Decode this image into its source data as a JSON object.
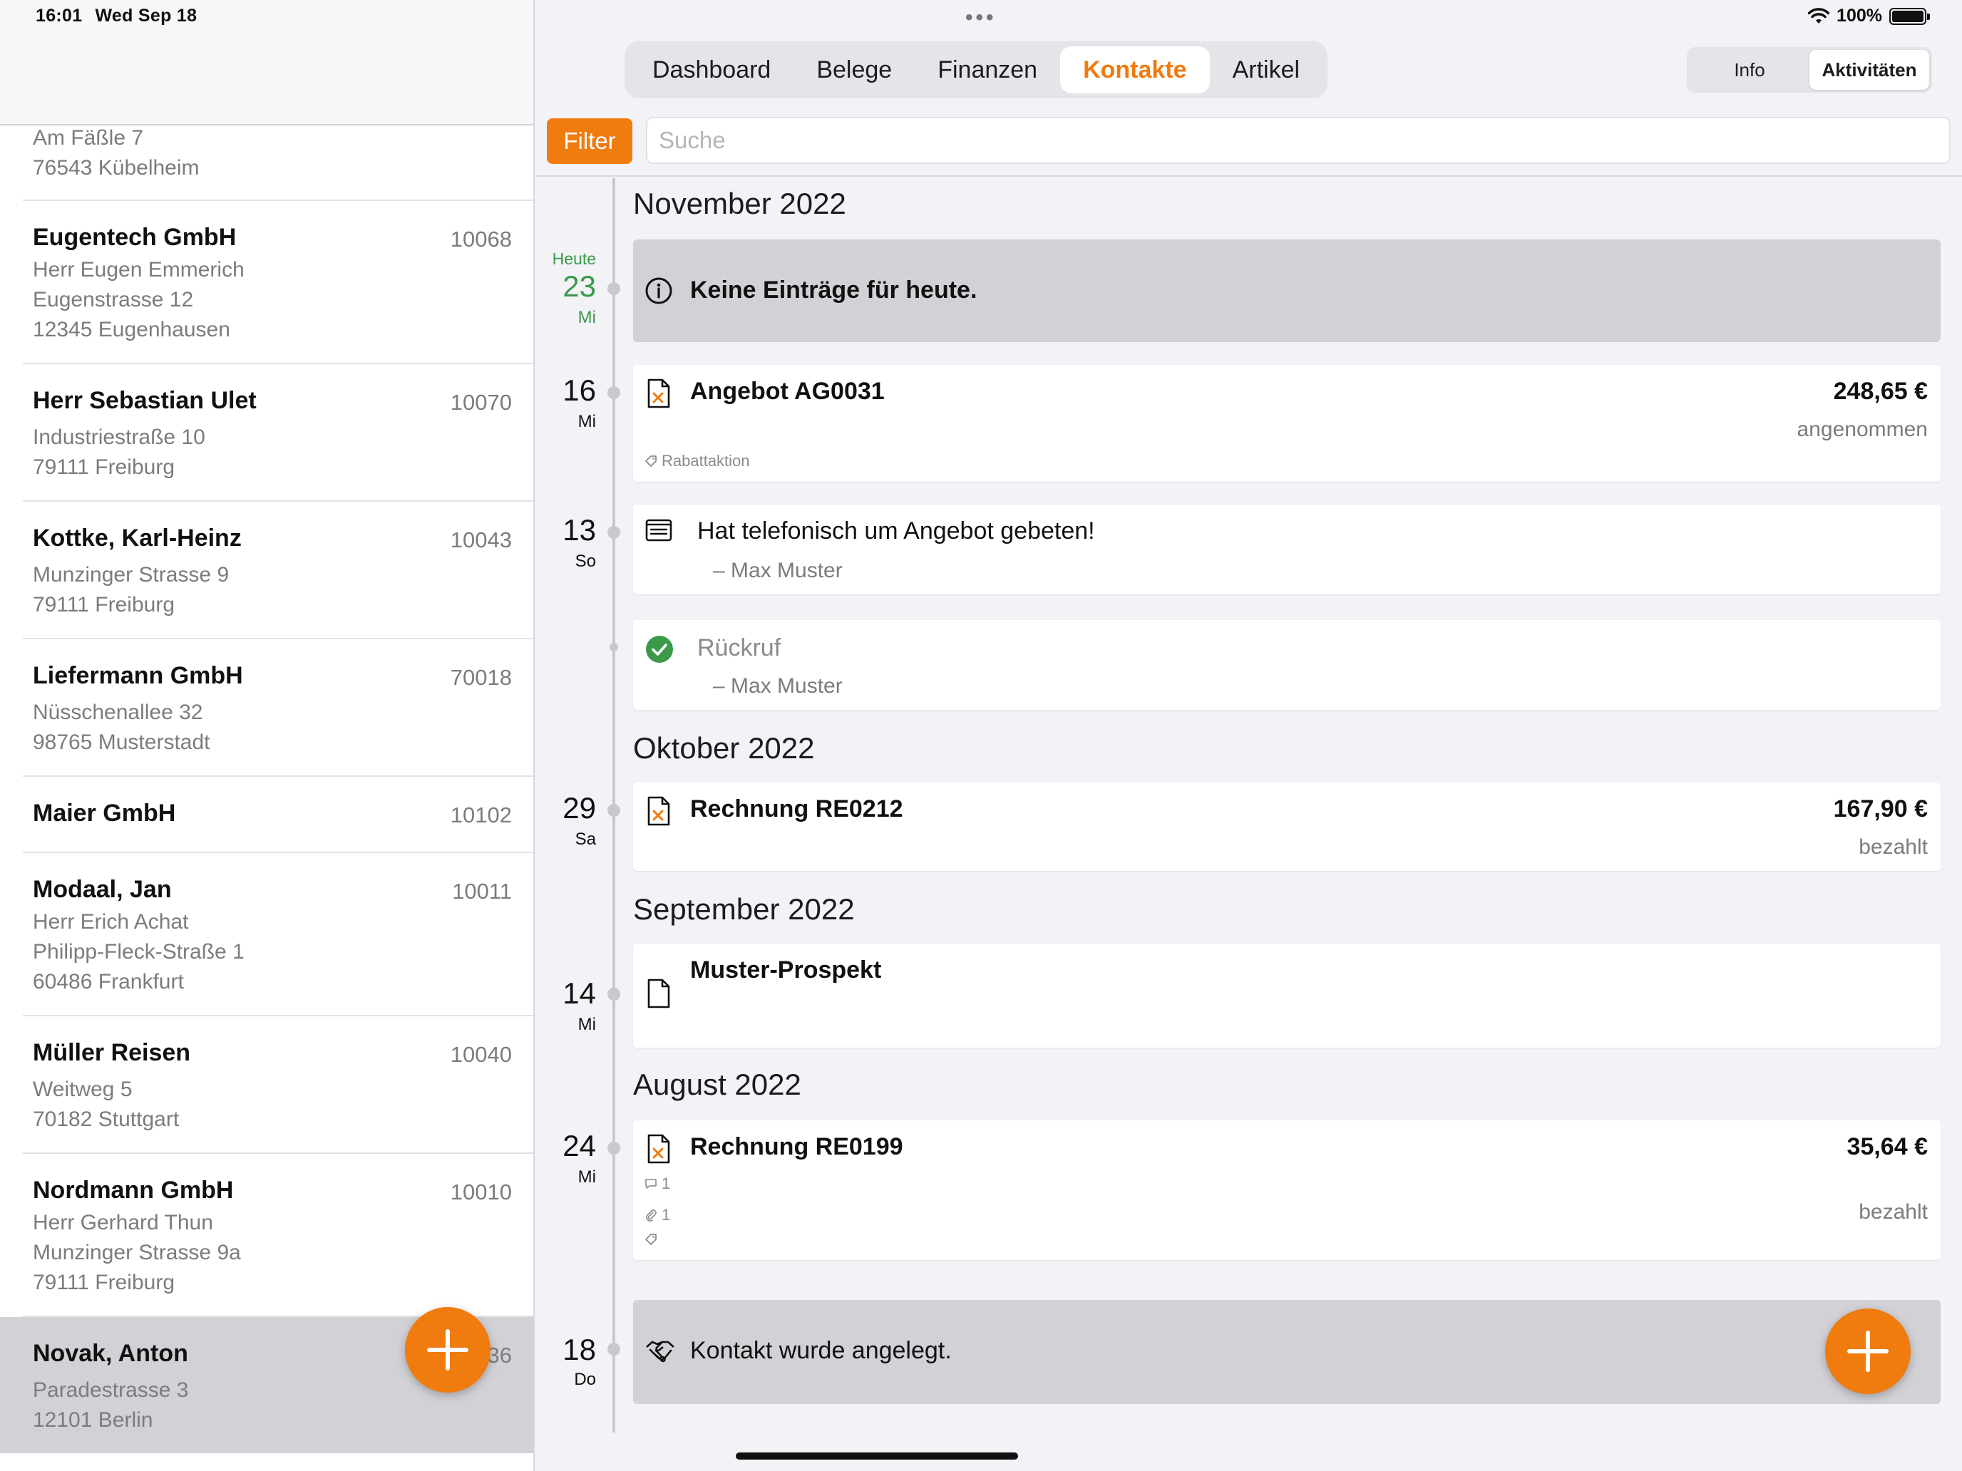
{
  "status": {
    "time": "16:01",
    "date": "Wed Sep 18",
    "battery": "100%"
  },
  "contacts": [
    {
      "name": "",
      "number": "",
      "lines": [
        "Am Fäßle 7",
        "76543  Kübelheim"
      ]
    },
    {
      "name": "Eugentech GmbH",
      "number": "10068",
      "lines": [
        "Herr Eugen Emmerich",
        "Eugenstrasse 12",
        "12345  Eugenhausen"
      ]
    },
    {
      "name": "Herr Sebastian Ulet",
      "number": "10070",
      "lines": [
        "Industriestraße 10",
        "79111  Freiburg"
      ]
    },
    {
      "name": "Kottke, Karl-Heinz",
      "number": "10043",
      "lines": [
        "Munzinger Strasse 9",
        "79111  Freiburg"
      ]
    },
    {
      "name": "Liefermann GmbH",
      "number": "70018",
      "lines": [
        "Nüsschenallee 32",
        "98765  Musterstadt"
      ]
    },
    {
      "name": "Maier GmbH",
      "number": "10102",
      "lines": []
    },
    {
      "name": "Modaal, Jan",
      "number": "10011",
      "lines": [
        "Herr Erich Achat",
        "Philipp-Fleck-Straße 1",
        "60486  Frankfurt"
      ]
    },
    {
      "name": "Müller Reisen",
      "number": "10040",
      "lines": [
        "Weitweg 5",
        "70182  Stuttgart"
      ]
    },
    {
      "name": "Nordmann GmbH",
      "number": "10010",
      "lines": [
        "Herr Gerhard Thun",
        "Munzinger Strasse 9a",
        "79111  Freiburg"
      ]
    },
    {
      "name": "Novak, Anton",
      "number": "36",
      "lines": [
        "Paradestrasse 3",
        "12101  Berlin"
      ],
      "selected": true
    }
  ],
  "tabs": [
    "Dashboard",
    "Belege",
    "Finanzen",
    "Kontakte",
    "Artikel"
  ],
  "active_tab": "Kontakte",
  "segments": {
    "info": "Info",
    "activities": "Aktivitäten"
  },
  "filter_label": "Filter",
  "search_placeholder": "Suche",
  "timeline": {
    "months": {
      "nov": "November 2022",
      "okt": "Oktober 2022",
      "sep": "September 2022",
      "aug": "August 2022"
    },
    "today": {
      "label": "Heute",
      "day": "23",
      "weekday": "Mi",
      "text": "Keine Einträge für heute."
    },
    "d16": {
      "day": "16",
      "weekday": "Mi",
      "title": "Angebot AG0031",
      "amount": "248,65 €",
      "status": "angenommen",
      "tag": "Rabattaktion"
    },
    "d13": {
      "day": "13",
      "weekday": "So",
      "title": "Hat telefonisch um Angebot gebeten!",
      "author": "– Max Muster"
    },
    "callback": {
      "title": "Rückruf",
      "author": "– Max Muster"
    },
    "d29": {
      "day": "29",
      "weekday": "Sa",
      "title": "Rechnung RE0212",
      "amount": "167,90 €",
      "status": "bezahlt"
    },
    "d14": {
      "day": "14",
      "weekday": "Mi",
      "title": "Muster-Prospekt"
    },
    "d24": {
      "day": "24",
      "weekday": "Mi",
      "title": "Rechnung RE0199",
      "amount": "35,64 €",
      "status": "bezahlt",
      "comments": "1",
      "attachments": "1"
    },
    "d18": {
      "day": "18",
      "weekday": "Do",
      "text": "Kontakt wurde angelegt."
    }
  },
  "colors": {
    "accent": "#f07b0e",
    "today": "#3a9a4a",
    "check": "#3a9a4a"
  }
}
